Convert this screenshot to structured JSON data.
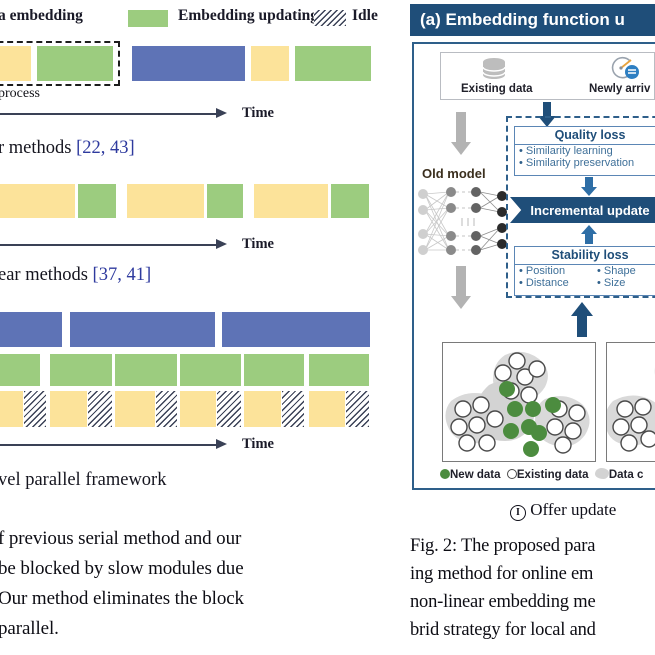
{
  "legend": {
    "item1_label": "a embedding",
    "item2_label": "Embedding updating",
    "item3_label": "Idle",
    "colors": {
      "yellow": "#fce39a",
      "green": "#9ccc7f",
      "blue": "#5e73b6",
      "idle_hatch": "#3a4156"
    }
  },
  "timelines": [
    {
      "id": "serial-top",
      "note_label": "process",
      "axis_label": "Time",
      "caption": "r methods ",
      "caption_ref": "[22, 43]"
    },
    {
      "id": "linear-methods",
      "axis_label": "Time",
      "caption": "ear methods ",
      "caption_ref": "[37, 41]"
    },
    {
      "id": "parallel-framework",
      "axis_label": "Time",
      "caption": "vel parallel framework"
    }
  ],
  "body_text": {
    "line1": "f previous serial method and our",
    "line2": "be blocked by slow modules due",
    "line3": "Our method eliminates the block",
    "line4": "parallel."
  },
  "figure": {
    "title": "(a)  Embedding function u",
    "inputs": {
      "existing_data": "Existing data",
      "newly_arrived": "Newly arriv"
    },
    "old_model_label": "Old model",
    "quality_loss": {
      "header": "Quality loss",
      "items": [
        "Similarity learning",
        "Similarity preservation"
      ]
    },
    "incremental_update": "Incremental update",
    "stability_loss": {
      "header": "Stability loss",
      "items_col1": [
        "Position",
        "Distance"
      ],
      "items_col2": [
        "Shape",
        "Size"
      ]
    },
    "scatter_legend": {
      "new_data": "New data",
      "existing_data": "Existing data",
      "data_cluster": "Data c"
    },
    "offer_update": "Offer update",
    "offer_marker": "I",
    "colors": {
      "title_bar": "#1f4e79",
      "frame": "#2e5f8a",
      "accent_blue": "#1f4e79",
      "new_data_green": "#4c8c3f",
      "cluster_gray": "#d3d3d3"
    }
  },
  "fig_caption": {
    "line1": "Fig. 2: The proposed para",
    "line2": "ing method for online em",
    "line3": "non-linear embedding me",
    "line4": "brid strategy for local and"
  }
}
